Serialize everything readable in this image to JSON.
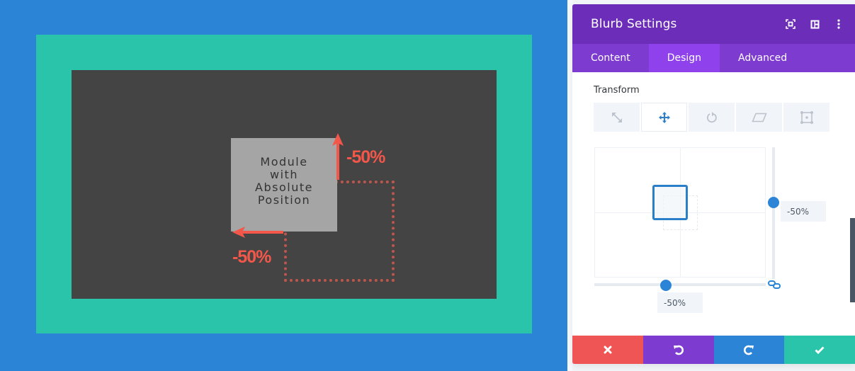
{
  "canvas": {
    "colors": {
      "outer": "#2b84d6",
      "section": "#29c4a9",
      "row": "#444444",
      "module": "#a5a5a5",
      "annotation": "#f2574a"
    },
    "module_text": [
      "Module",
      "with",
      "Absolute",
      "Position"
    ],
    "annotations": {
      "vertical": "-50%",
      "horizontal": "-50%"
    }
  },
  "panel": {
    "title": "Blurb Settings",
    "header_icons": [
      "focus-mode-icon",
      "sidebar-layout-icon",
      "more-options-icon"
    ],
    "tabs": [
      {
        "label": "Content",
        "active": false
      },
      {
        "label": "Design",
        "active": true
      },
      {
        "label": "Advanced",
        "active": false
      }
    ],
    "section_title": "Transform",
    "transform_tabs": [
      {
        "name": "scale",
        "icon": "scale-icon",
        "active": false
      },
      {
        "name": "translate",
        "icon": "move-icon",
        "active": true
      },
      {
        "name": "rotate",
        "icon": "rotate-icon",
        "active": false
      },
      {
        "name": "skew",
        "icon": "skew-icon",
        "active": false
      },
      {
        "name": "origin",
        "icon": "transform-origin-icon",
        "active": false
      }
    ],
    "translate": {
      "y_value": "-50%",
      "x_value": "-50%",
      "linked": true
    },
    "colors": {
      "header": "#6c2eb9",
      "tabs": "#7e3bd0",
      "active_tab": "#8f42ec",
      "accent": "#2b84d6"
    }
  },
  "footer": {
    "buttons": [
      {
        "name": "discard",
        "icon": "close-icon",
        "color": "#ef5555"
      },
      {
        "name": "undo",
        "icon": "undo-icon",
        "color": "#7e3bd0"
      },
      {
        "name": "redo",
        "icon": "redo-icon",
        "color": "#2b84d6"
      },
      {
        "name": "save",
        "icon": "check-icon",
        "color": "#29c4a9"
      }
    ]
  }
}
